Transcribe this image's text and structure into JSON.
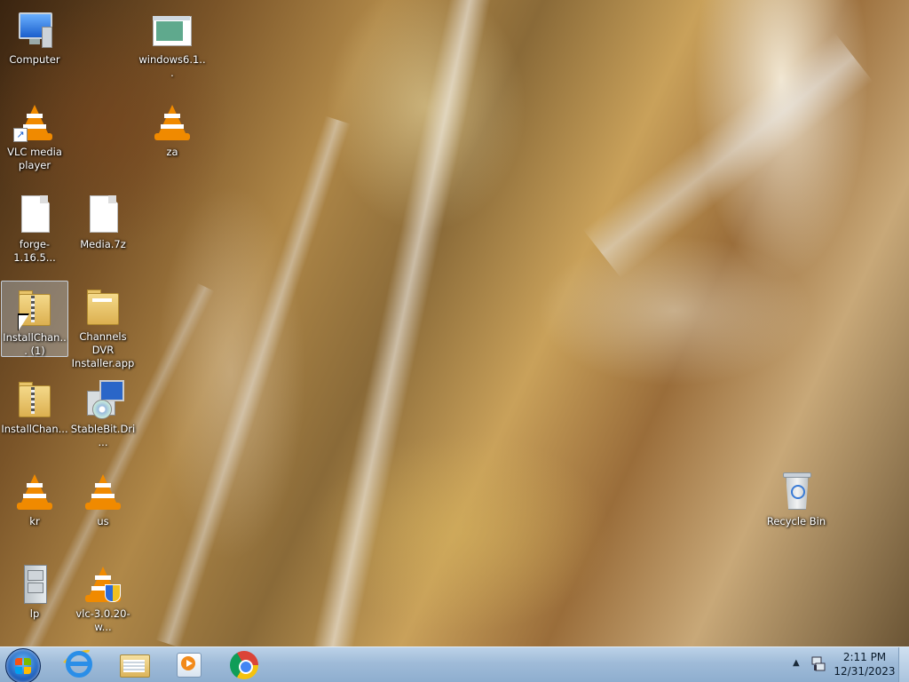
{
  "desktop": {
    "icons": [
      {
        "label": "Computer"
      },
      {
        "label": "windows6.1..."
      },
      {
        "label": "VLC media player"
      },
      {
        "label": "za"
      },
      {
        "label": "forge-1.16.5..."
      },
      {
        "label": "Media.7z"
      },
      {
        "label": "InstallChan... (1)",
        "selected": true
      },
      {
        "label": "Channels DVR Installer.app"
      },
      {
        "label": "InstallChan..."
      },
      {
        "label": "StableBit.Dri..."
      },
      {
        "label": "kr"
      },
      {
        "label": "us"
      },
      {
        "label": "lp"
      },
      {
        "label": "vlc-3.0.20-w..."
      },
      {
        "label": "Recycle Bin"
      }
    ],
    "icon_names": [
      "computer-icon",
      "screenshot-file-icon",
      "vlc-icon",
      "vlc-icon",
      "document-icon",
      "document-icon",
      "zip-folder-icon",
      "folder-icon",
      "zip-folder-icon",
      "setup-icon",
      "vlc-icon",
      "vlc-icon",
      "file-cabinet-icon",
      "vlc-installer-icon",
      "recycle-bin-icon"
    ]
  },
  "taskbar": {
    "start_icon": "windows-start-orb",
    "pinned": [
      {
        "name": "internet-explorer-icon"
      },
      {
        "name": "file-explorer-icon"
      },
      {
        "name": "media-player-icon"
      },
      {
        "name": "chrome-icon"
      }
    ],
    "tray": {
      "overflow_arrow": "▲",
      "network_icon": "network-icon"
    },
    "clock": {
      "time": "2:11 PM",
      "date": "12/31/2023"
    }
  },
  "colors": {
    "taskbar": "#9fbbd8",
    "selection": "#bed7f0"
  }
}
